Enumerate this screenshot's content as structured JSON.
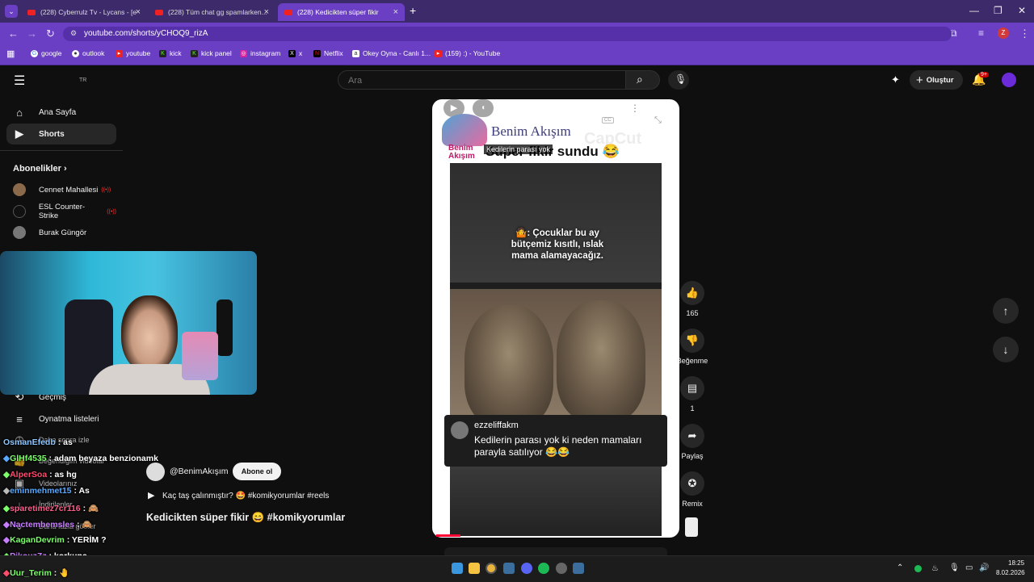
{
  "browser": {
    "tabs": [
      {
        "label": "(228) Cyberrulz Tv - Lycans - [e"
      },
      {
        "label": "(228) Tüm chat gg spamlarken..."
      },
      {
        "label": "(228) Kedicikten süper fikir"
      }
    ],
    "url": "youtube.com/shorts/yCHOQ9_rizA",
    "bookmarks": [
      "google",
      "outlook",
      "youtube",
      "kick",
      "kick panel",
      "instagram",
      "x",
      "Netflix",
      "Okey Oyna - Canlı 1...",
      "(159) :) - YouTube"
    ]
  },
  "header": {
    "region": "TR",
    "search_placeholder": "Ara",
    "create_label": "Oluştur",
    "notif_badge": "9+"
  },
  "sidebar": {
    "home": "Ana Sayfa",
    "shorts": "Shorts",
    "subs_title": "Abonelikler",
    "subs": [
      "Cennet Mahallesi",
      "ESL Counter-Strike",
      "Burak Güngör"
    ],
    "lower": [
      "Geçmiş",
      "Oynatma listeleri",
      "Daha sonra izle",
      "Beğendiğim videolar",
      "Videolarınız",
      "İndirilenler",
      "Daha fazla göster"
    ]
  },
  "video": {
    "brand": "Benim Akışım",
    "brand_short": "Benim\nAkışım",
    "caption_chip": "Kedilerin parası yok",
    "heading": "Süper fikir sundu 😂",
    "overlay_text": "🤷: Çocuklar bu ay bütçemiz kısıtlı, ıslak mama alamayacağız.",
    "comment_user": "ezzeliffakm",
    "comment_text": "Kedilerin parası yok ki neden mamaları parayla satılıyor 😂😂",
    "channel": "@BenimAkışım",
    "subscribe": "Abone ol",
    "desc": "Kaç taş çalınmıştır? 🤩 #komikyorumlar #reels",
    "title": "Kedicikten süper fikir 😄 #komikyorumlar",
    "cc": "CC",
    "watermark": "CapCut"
  },
  "actions": {
    "likes": "165",
    "dislike": "Beğenme",
    "comments": "1",
    "share": "Paylaş",
    "remix": "Remix"
  },
  "chat": [
    {
      "user": "OsmanEfedb",
      "msg": ": as",
      "color": "#8ec5ff"
    },
    {
      "user": "GlHf4535",
      "msg": ": adam beyaza benzionamk",
      "color": "#7cff6b"
    },
    {
      "user": "AlperSoa",
      "msg": ": as hg",
      "color": "#ff4d6d"
    },
    {
      "user": "eminmehmet15",
      "msg": ": As",
      "color": "#5aa9ff"
    },
    {
      "user": "sparetimez7cr116",
      "msg": ": 🙈",
      "color": "#ff5c8a"
    },
    {
      "user": "Nactembemsles",
      "msg": ": 🙈",
      "color": "#c77dff"
    },
    {
      "user": "KaganDevrim",
      "msg": ": YERİM ?",
      "color": "#7cff6b"
    },
    {
      "user": "PikouzZz",
      "msg": ": korkunç",
      "color": "#c77dff"
    },
    {
      "user": "Uur_Terim",
      "msg": ": 🤚",
      "color": "#7cff6b"
    }
  ],
  "taskbar": {
    "time": "18:25",
    "date": "8.02.2026"
  }
}
